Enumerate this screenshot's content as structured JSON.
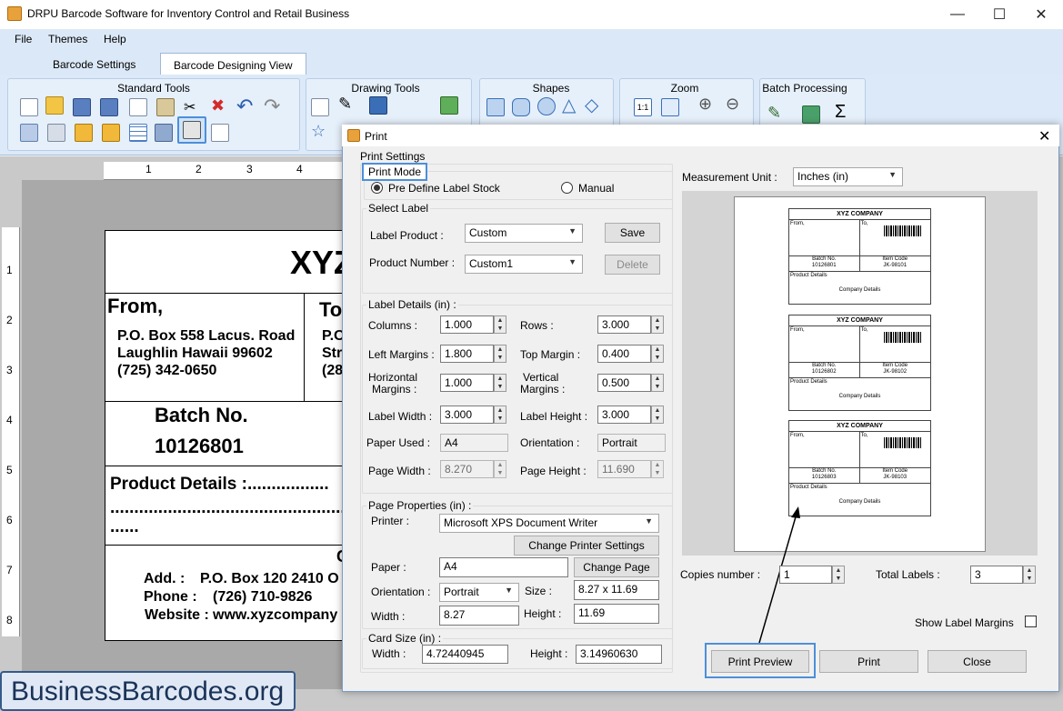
{
  "window": {
    "title": "DRPU Barcode Software for Inventory Control and Retail Business"
  },
  "menu": [
    "File",
    "Themes",
    "Help"
  ],
  "tabs": [
    "Barcode Settings",
    "Barcode Designing View"
  ],
  "ribbon": {
    "groups": [
      "Standard Tools",
      "Drawing Tools",
      "Shapes",
      "Zoom",
      "Batch Processing"
    ]
  },
  "rulers": {
    "h": [
      "1",
      "2",
      "3",
      "4"
    ],
    "v": [
      "1",
      "2",
      "3",
      "4",
      "5",
      "6",
      "7",
      "8"
    ]
  },
  "label": {
    "company": "XYZ",
    "from_title": "From,",
    "from_lines": [
      "P.O. Box 558 Lacus. Road",
      "Laughlin Hawaii 99602",
      "(725) 342-0650"
    ],
    "to_title": "To",
    "to_lines": [
      "P.O",
      "Str",
      "(28"
    ],
    "batch_title": "Batch No.",
    "batch_value": "10126801",
    "product": "Product Details :.................",
    "dots": "...................................................",
    "dots2": "......",
    "cmp": "C",
    "add_k": "Add. :",
    "add_v": "P.O. Box 120 2410 O",
    "phone_k": "Phone :",
    "phone_v": "(726) 710-9826",
    "web_k": "Website :",
    "web_v": "www.xyzcompany"
  },
  "dialog": {
    "title": "Print",
    "print_settings": "Print Settings",
    "print_mode": "Print Mode",
    "mode_options": [
      "Pre Define Label Stock",
      "Manual"
    ],
    "select_label": "Select Label",
    "label_product_k": "Label Product :",
    "label_product_v": "Custom",
    "save": "Save",
    "product_number_k": "Product Number :",
    "product_number_v": "Custom1",
    "delete": "Delete",
    "label_details": "Label Details (in) :",
    "columns_k": "Columns :",
    "columns_v": "1.000",
    "rows_k": "Rows :",
    "rows_v": "3.000",
    "left_k": "Left Margins :",
    "left_v": "1.800",
    "top_k": "Top Margin :",
    "top_v": "0.400",
    "hmargin_k1": "Horizontal",
    "hmargin_k2": "Margins :",
    "hmargin_v": "1.000",
    "vmargin_k1": "Vertical",
    "vmargin_k2": "Margins :",
    "vmargin_v": "0.500",
    "lw_k": "Label Width :",
    "lw_v": "3.000",
    "lh_k": "Label Height :",
    "lh_v": "3.000",
    "paper_used_k": "Paper Used :",
    "paper_used_v": "A4",
    "orient_k": "Orientation :",
    "orient_v": "Portrait",
    "pw_k": "Page Width :",
    "pw_v": "8.270",
    "ph_k": "Page Height :",
    "ph_v": "11.690",
    "page_props": "Page Properties (in) :",
    "printer_k": "Printer :",
    "printer_v": "Microsoft XPS Document Writer",
    "change_printer": "Change Printer Settings",
    "paper_k": "Paper :",
    "paper_v": "A4",
    "change_page": "Change Page",
    "orientation_k": "Orientation :",
    "orientation_v": "Portrait",
    "size_k": "Size :",
    "size_v": "8.27 x 11.69",
    "width_k": "Width :",
    "width_v": "8.27",
    "height_k": "Height :",
    "height_v": "11.69",
    "card_size": "Card Size (in) :",
    "card_w_k": "Width :",
    "card_w_v": "4.72440945",
    "card_h_k": "Height :",
    "card_h_v": "3.14960630",
    "measure_k": "Measurement Unit :",
    "measure_v": "Inches (in)",
    "copies_k": "Copies number :",
    "copies_v": "1",
    "total_k": "Total Labels :",
    "total_v": "3",
    "show_margins": "Show Label Margins",
    "print_preview": "Print Preview",
    "print": "Print",
    "close": "Close"
  },
  "preview": {
    "company": "XYZ COMPANY",
    "labels": [
      {
        "batch": "10126801",
        "item": "JK-98101"
      },
      {
        "batch": "10126802",
        "item": "JK-98102"
      },
      {
        "batch": "10126803",
        "item": "JK-98103"
      }
    ],
    "from": "From,",
    "to": "To,",
    "batch_k": "Batch No.",
    "item_k": "Item Code",
    "product": "Product Details",
    "company_details": "Company Details"
  },
  "watermark": "BusinessBarcodes.org"
}
